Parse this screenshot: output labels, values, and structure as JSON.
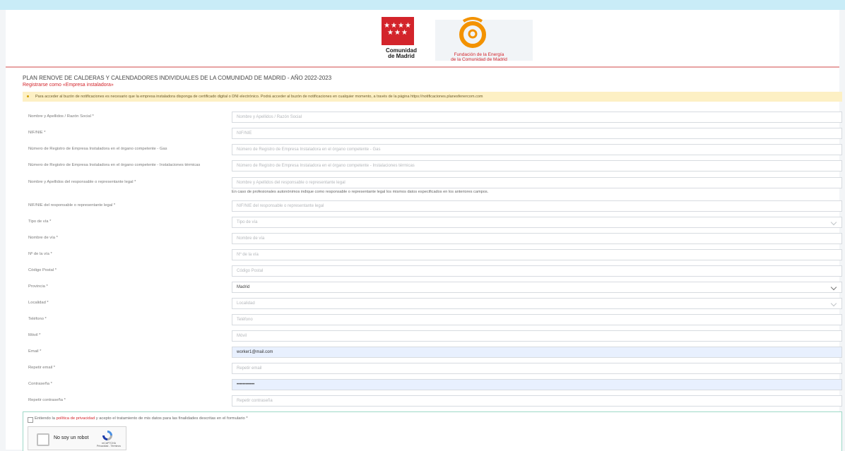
{
  "header": {
    "cm_logo_text": "Comunidad\nde Madrid",
    "cm_logo_text_1": "Comunidad",
    "cm_logo_text_2": "de Madrid",
    "fe_logo_text_1": "Fundación de la Energía",
    "fe_logo_text_2": "de la Comunidad de Madrid"
  },
  "page": {
    "title": "PLAN RENOVE DE CALDERAS Y CALENDADORES INDIVIDUALES DE LA COMUNIDAD DE MADRID - AÑO 2022-2023",
    "subtitle": "Registrarse como «Empresa instaladora»",
    "notice": "Para acceder al buzón de notificaciones es necesario que la empresa instaladora disponga de certificado digital o DNI electrónico. Podrá acceder al buzón de notificaciones en cualquier momento, a través de la página https://notificaciones.planesfenercom.com"
  },
  "form": {
    "fields": [
      {
        "label": "Nombre y Apellidos / Razón Social *",
        "placeholder": "Nombre y Apellidos / Razón Social",
        "value": ""
      },
      {
        "label": "NIF/NIE *",
        "placeholder": "NIF/NIE",
        "value": ""
      },
      {
        "label": "Número de Registro de Empresa Instaladora en el órgano competente - Gas",
        "placeholder": "Número de Registro de Empresa Instaladora en el órgano competente - Gas",
        "value": ""
      },
      {
        "label": "Número de Registro de Empresa Instaladora en el órgano competente - Instalaciones térmicas",
        "placeholder": "Número de Registro de Empresa Instaladora en el órgano competente - Instalaciones térmicas",
        "value": ""
      },
      {
        "label": "Nombre y Apellidos del responsable o representante legal *",
        "placeholder": "Nombre y Apellidos del responsable o representante legal",
        "value": "",
        "help": "En caso de profesionales autonónimos indique como responsable o representante legal los mismos datos especificados en los anteriores campos."
      },
      {
        "label": "NIF/NIE del responsable o representante legal *",
        "placeholder": "NIF/NIE del responsable o representante legal",
        "value": ""
      },
      {
        "label": "Tipo de vía *",
        "placeholder": "Tipo de vía",
        "value": "",
        "type": "select"
      },
      {
        "label": "Nombre de vía *",
        "placeholder": "Nombre de vía",
        "value": ""
      },
      {
        "label": "Nº de la vía *",
        "placeholder": "Nº de la vía",
        "value": ""
      },
      {
        "label": "Código Postal *",
        "placeholder": "Código Postal",
        "value": ""
      },
      {
        "label": "Provincia *",
        "placeholder": "",
        "value": "Madrid",
        "type": "select"
      },
      {
        "label": "Localidad *",
        "placeholder": "Localidad",
        "value": "",
        "type": "select"
      },
      {
        "label": "Teléfono *",
        "placeholder": "Teléfono",
        "value": ""
      },
      {
        "label": "Móvil *",
        "placeholder": "Móvil",
        "value": ""
      },
      {
        "label": "Email *",
        "placeholder": "",
        "value": "worker1@mail.com",
        "autofill": true
      },
      {
        "label": "Repetir email *",
        "placeholder": "Repetir email",
        "value": ""
      },
      {
        "label": "Contraseña *",
        "placeholder": "",
        "value": "••••••••••••",
        "autofill": true
      },
      {
        "label": "Repetir contraseña *",
        "placeholder": "Repetir contraseña",
        "value": ""
      }
    ]
  },
  "consent": {
    "prefix": "Entiendo la ",
    "link": "política de privacidad",
    "suffix": " y acepto el tratamiento de mis datos para las finalidades descritas en el formulario *"
  },
  "recaptcha": {
    "label": "No soy un robot",
    "brand": "reCAPTCHA",
    "links": "Privacidad - Términos"
  },
  "colors": {
    "brand_red": "#d3242b",
    "brand_orange": "#f39200",
    "autofill_bg": "#e8f0fe",
    "notice_bg": "#fdf0c4"
  }
}
